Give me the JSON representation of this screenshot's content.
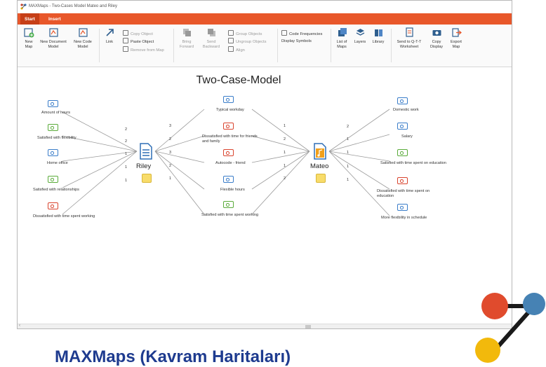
{
  "window": {
    "title": "MAXMaps - Two-Cases Model Mateo and Riley"
  },
  "menu": {
    "tabs": [
      "Start",
      "Insert"
    ]
  },
  "ribbon": {
    "new_map": "New\nMap",
    "new_document_model": "New Document\nModel",
    "new_code_model": "New Code\nModel",
    "link": "Link",
    "copy_object": "Copy Object",
    "paste_object": "Paste Object",
    "remove_from_map": "Remove from Map",
    "bring_forward": "Bring\nForward",
    "send_backward": "Send\nBackward",
    "group_objects": "Group Objects",
    "ungroup_objects": "Ungroup Objects",
    "align": "Align",
    "code_frequencies": "Code Frequencies",
    "display_symbols": "Display Symbols",
    "list_of_maps": "List of\nMaps",
    "layers": "Layers",
    "library": "Library",
    "send_to_qtt": "Send to Q-T-T\nWorksheet",
    "copy_display": "Copy\nDisplay",
    "export_map": "Export\nMap"
  },
  "map": {
    "title": "Two-Case-Model",
    "case_left": "Riley",
    "case_right": "Mateo",
    "left_codes": [
      "Amount of hours",
      "Satisfied with flexibility",
      "Home office",
      "Satisfied with relationships",
      "Dissatisfied with time spent working"
    ],
    "center_codes": [
      "Typical workday",
      "Dissatisfied with time for friends and family",
      "Autocode - friend",
      "Flexible hours",
      "Satisfied with time spent working"
    ],
    "right_codes": [
      "Domestic work",
      "Salary",
      "Satisfied with time spent on education",
      "Dissatisfied with time spent on education",
      "More flexibility in schedule"
    ],
    "weights": {
      "left": [
        "2",
        "2",
        "1",
        "1",
        "1"
      ],
      "center_left": [
        "3",
        "2",
        "3",
        "2",
        "1"
      ],
      "center_right": [
        "1",
        "2",
        "1",
        "1",
        "2"
      ],
      "right": [
        "2",
        "1",
        "1",
        "1",
        "1"
      ]
    }
  },
  "colors": {
    "accent": "#e8572a",
    "blue_code": "#3a7dc9",
    "green_code": "#5aab3a",
    "red_code": "#d9442e",
    "brand": "#1e3b8f"
  },
  "brand_text": "MAXMaps (Kavram Haritaları)"
}
